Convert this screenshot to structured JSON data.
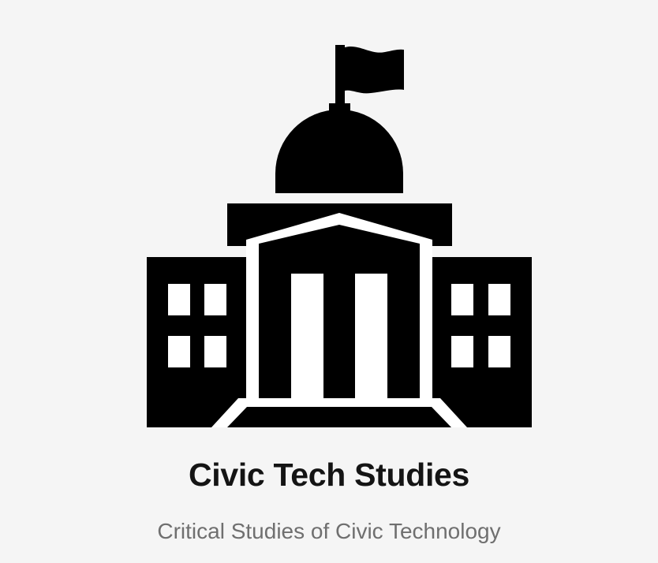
{
  "site": {
    "logo_icon": "capitol-building-icon",
    "title": "Civic Tech Studies",
    "description": "Critical Studies of Civic Technology"
  },
  "colors": {
    "background": "#f5f5f5",
    "logo": "#000000",
    "title": "#141414",
    "description": "#6f6f6f"
  }
}
